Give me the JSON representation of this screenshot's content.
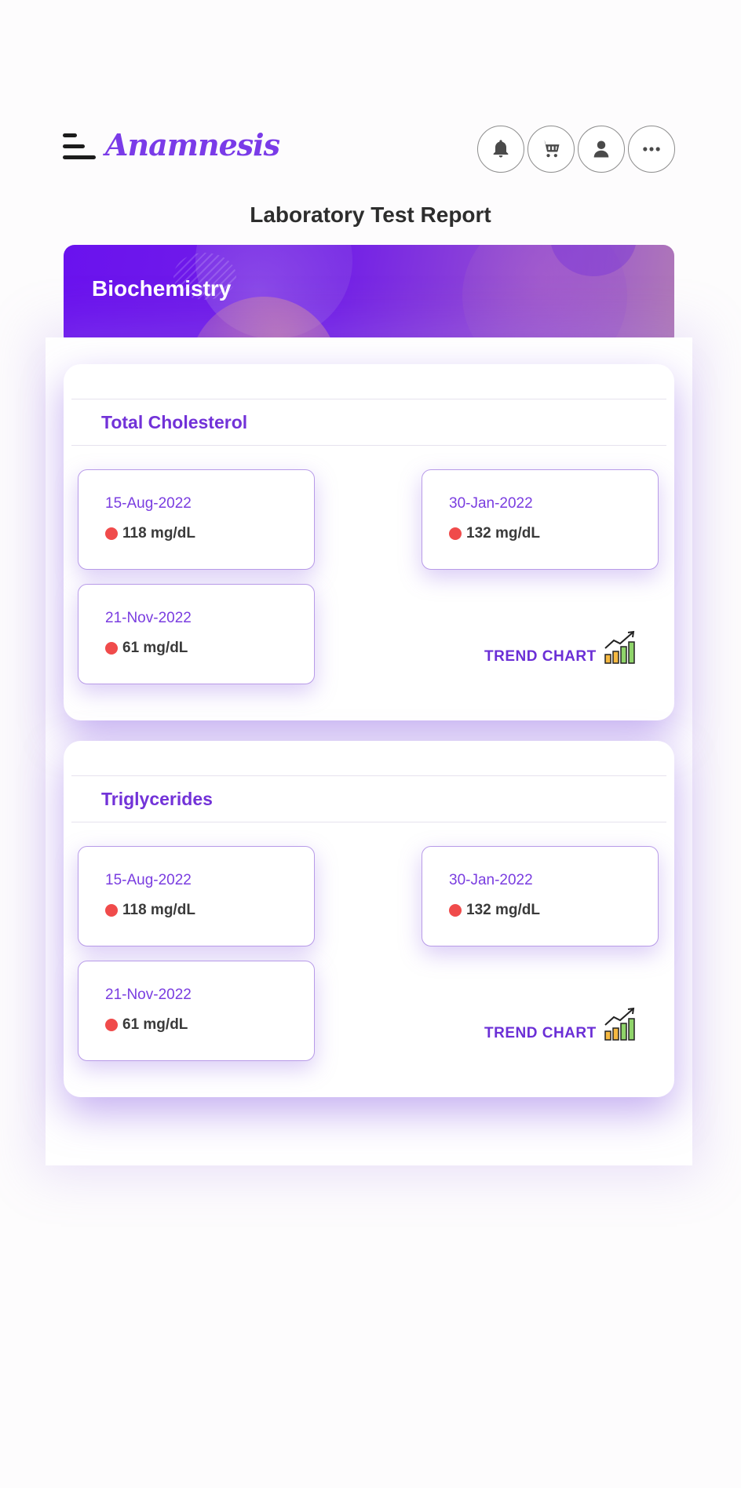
{
  "header": {
    "logo": "Anamnesis",
    "icons": [
      "bell-icon",
      "cart-icon",
      "user-icon",
      "more-icon"
    ]
  },
  "page_title": "Laboratory Test Report",
  "banner": {
    "title": "Biochemistry"
  },
  "tests": [
    {
      "name": "Total Cholesterol",
      "readings": [
        {
          "date": "15-Aug-2022",
          "value": "118 mg/dL",
          "status": "#f04b4b"
        },
        {
          "date": "30-Jan-2022",
          "value": "132 mg/dL",
          "status": "#f04b4b"
        },
        {
          "date": "21-Nov-2022",
          "value": "61 mg/dL",
          "status": "#f04b4b"
        }
      ],
      "trend_label": "TREND CHART"
    },
    {
      "name": "Triglycerides",
      "readings": [
        {
          "date": "15-Aug-2022",
          "value": "118 mg/dL",
          "status": "#f04b4b"
        },
        {
          "date": "30-Jan-2022",
          "value": "132 mg/dL",
          "status": "#f04b4b"
        },
        {
          "date": "21-Nov-2022",
          "value": "61 mg/dL",
          "status": "#f04b4b"
        }
      ],
      "trend_label": "TREND CHART"
    }
  ],
  "colors": {
    "accent": "#7232d8",
    "banner_start": "#6a12ee",
    "status_high": "#f04b4b"
  }
}
